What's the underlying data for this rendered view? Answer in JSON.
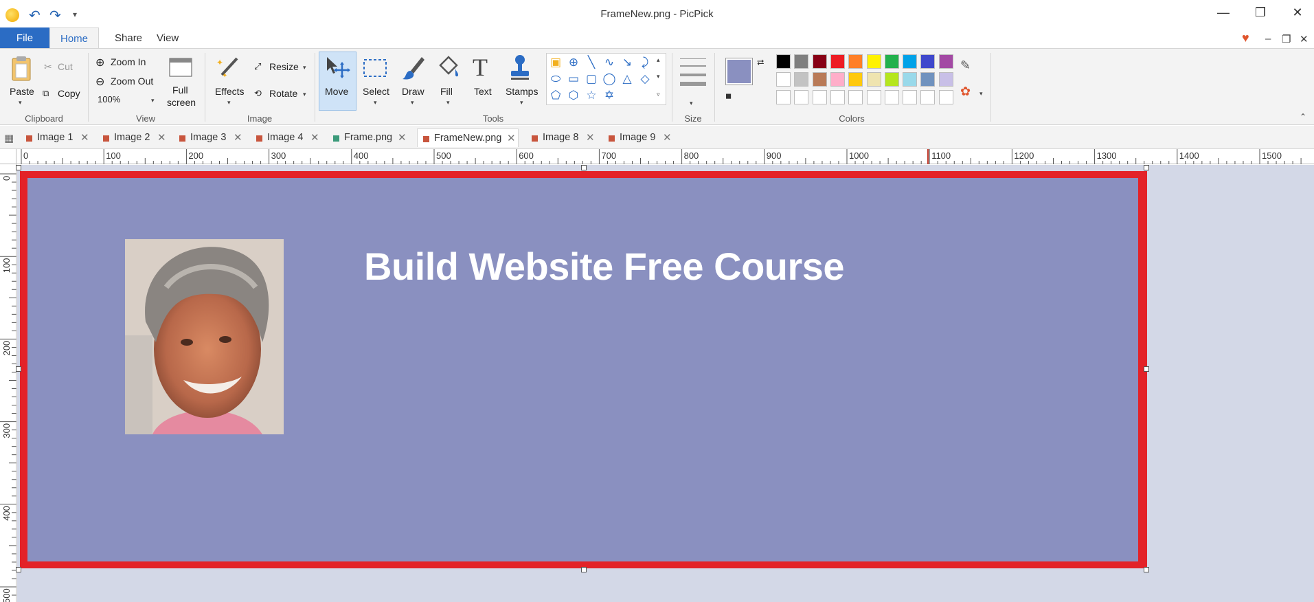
{
  "window": {
    "title": "FrameNew.png - PicPick",
    "minimize_icon": "minimize-icon",
    "restore_icon": "restore-icon",
    "close_icon": "close-icon"
  },
  "quick_access": {
    "undo": "undo-icon",
    "redo": "redo-icon",
    "customize": "customize-icon"
  },
  "ribbon_tabs": {
    "file": "File",
    "home": "Home",
    "share": "Share",
    "view": "View"
  },
  "clipboard": {
    "paste": "Paste",
    "cut": "Cut",
    "copy": "Copy",
    "label": "Clipboard"
  },
  "view_group": {
    "zoom_in": "Zoom In",
    "zoom_out": "Zoom Out",
    "zoom_level": "100%",
    "full_screen_1": "Full",
    "full_screen_2": "screen",
    "label": "View"
  },
  "image_group": {
    "effects": "Effects",
    "resize": "Resize",
    "rotate": "Rotate",
    "label": "Image"
  },
  "tools_group": {
    "move": "Move",
    "select": "Select",
    "draw": "Draw",
    "fill": "Fill",
    "text": "Text",
    "stamps": "Stamps",
    "label": "Tools"
  },
  "size_group": {
    "label": "Size"
  },
  "colors_group": {
    "label": "Colors",
    "primary": "#8a90c0",
    "secondary": "#ffffff",
    "palette_row1": [
      "#000000",
      "#7f7f7f",
      "#880015",
      "#ed1c24",
      "#ff7f27",
      "#fff200",
      "#22b14c",
      "#00a2e8",
      "#3f48cc",
      "#a349a4"
    ],
    "palette_row2": [
      "#ffffff",
      "#c3c3c3",
      "#b97a57",
      "#ffaec9",
      "#ffc90e",
      "#efe4b0",
      "#b5e61d",
      "#99d9ea",
      "#7092be",
      "#c8bfe7"
    ],
    "palette_row3": [
      "#ffffff",
      "#ffffff",
      "#ffffff",
      "#ffffff",
      "#ffffff",
      "#ffffff",
      "#ffffff",
      "#ffffff",
      "#ffffff",
      "#ffffff"
    ]
  },
  "doc_tabs": [
    {
      "label": "Image 1",
      "color": "#c8553d"
    },
    {
      "label": "Image 2",
      "color": "#c8553d"
    },
    {
      "label": "Image 3",
      "color": "#c8553d"
    },
    {
      "label": "Image 4",
      "color": "#c8553d"
    },
    {
      "label": "Frame.png",
      "color": "#3b9a7a"
    },
    {
      "label": "FrameNew.png",
      "color": "#c8553d"
    },
    {
      "label": "Image 8",
      "color": "#c8553d"
    },
    {
      "label": "Image 9",
      "color": "#c8553d"
    }
  ],
  "ruler": {
    "h_labels": [
      "0",
      "100",
      "200",
      "300",
      "400",
      "500",
      "600",
      "700",
      "800",
      "900",
      "1000",
      "1100",
      "1200",
      "1300",
      "1400",
      "1500"
    ],
    "v_labels": [
      "0",
      "100",
      "200",
      "300",
      "400",
      "500"
    ]
  },
  "canvas": {
    "headline": "Build Website Free Course",
    "frame_color": "#e32228",
    "background_color": "#8a90c0"
  }
}
